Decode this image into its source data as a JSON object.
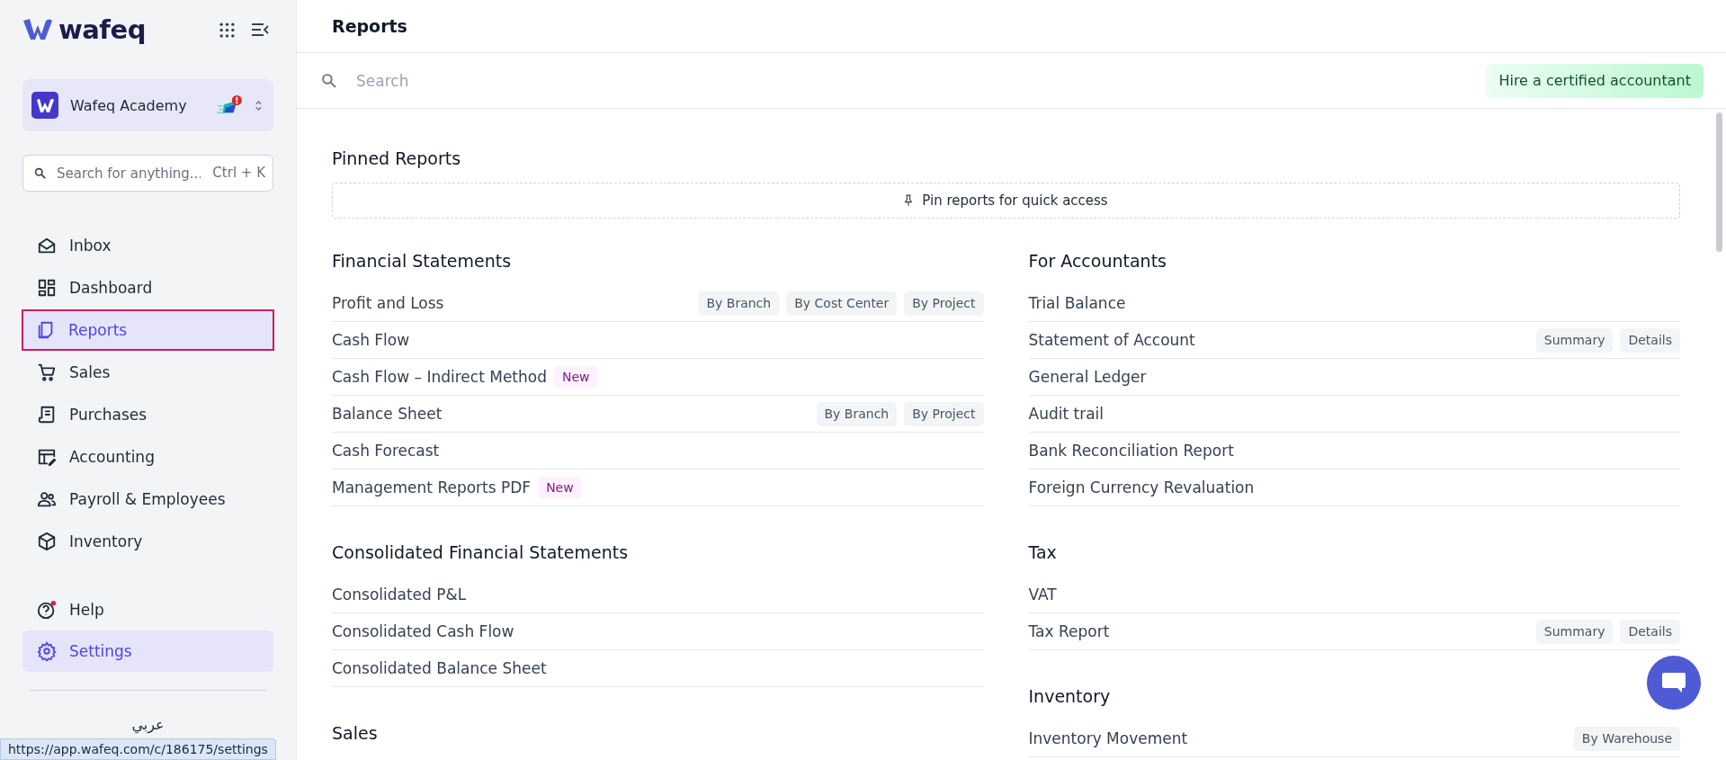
{
  "sidebar": {
    "logo": "wafeq",
    "org": {
      "name": "Wafeq Academy",
      "alert": true
    },
    "search": {
      "placeholder": "Search for anything...",
      "shortcut": "Ctrl + K"
    },
    "nav": [
      {
        "label": "Inbox",
        "selected": false,
        "outlined": false
      },
      {
        "label": "Dashboard",
        "selected": false,
        "outlined": false
      },
      {
        "label": "Reports",
        "selected": true,
        "outlined": true
      },
      {
        "label": "Sales",
        "selected": false,
        "outlined": false
      },
      {
        "label": "Purchases",
        "selected": false,
        "outlined": false
      },
      {
        "label": "Accounting",
        "selected": false,
        "outlined": false
      },
      {
        "label": "Payroll & Employees",
        "selected": false,
        "outlined": false
      },
      {
        "label": "Inventory",
        "selected": false,
        "outlined": false
      }
    ],
    "bottom_nav": [
      {
        "label": "Help",
        "hovered": false,
        "dot": true
      },
      {
        "label": "Settings",
        "hovered": true,
        "dot": false
      }
    ],
    "language": "عربي"
  },
  "status_url": "https://app.wafeq.com/c/186175/settings",
  "header": {
    "title": "Reports"
  },
  "search": {
    "placeholder": "Search"
  },
  "hire_button": "Hire a certified accountant",
  "pinned": {
    "title": "Pinned Reports",
    "empty": "Pin reports for quick access"
  },
  "left_sections": [
    {
      "title": "Financial Statements",
      "reports": [
        {
          "name": "Profit and Loss",
          "tags": [
            "By Branch",
            "By Cost Center",
            "By Project"
          ]
        },
        {
          "name": "Cash Flow"
        },
        {
          "name": "Cash Flow – Indirect Method",
          "badge": "New"
        },
        {
          "name": "Balance Sheet",
          "tags": [
            "By Branch",
            "By Project"
          ]
        },
        {
          "name": "Cash Forecast"
        },
        {
          "name": "Management Reports PDF",
          "badge": "New"
        }
      ]
    },
    {
      "title": "Consolidated Financial Statements",
      "reports": [
        {
          "name": "Consolidated P&L"
        },
        {
          "name": "Consolidated Cash Flow"
        },
        {
          "name": "Consolidated Balance Sheet"
        }
      ]
    },
    {
      "title": "Sales"
    }
  ],
  "right_sections": [
    {
      "title": "For Accountants",
      "reports": [
        {
          "name": "Trial Balance"
        },
        {
          "name": "Statement of Account",
          "tags": [
            "Summary",
            "Details"
          ]
        },
        {
          "name": "General Ledger"
        },
        {
          "name": "Audit trail"
        },
        {
          "name": "Bank Reconciliation Report"
        },
        {
          "name": "Foreign Currency Revaluation"
        }
      ]
    },
    {
      "title": "Tax",
      "reports": [
        {
          "name": "VAT"
        },
        {
          "name": "Tax Report",
          "tags": [
            "Summary",
            "Details"
          ]
        }
      ]
    },
    {
      "title": "Inventory",
      "reports": [
        {
          "name": "Inventory Movement",
          "tags": [
            "By Warehouse"
          ]
        }
      ]
    }
  ]
}
